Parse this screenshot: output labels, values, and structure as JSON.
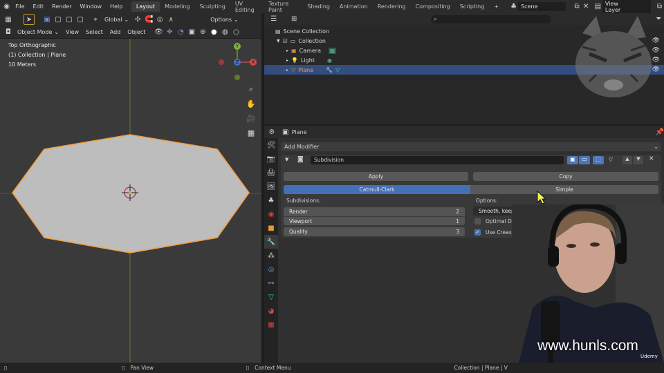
{
  "topbar": {
    "menus": [
      "File",
      "Edit",
      "Render",
      "Window",
      "Help"
    ],
    "workspaces": [
      "Layout",
      "Modeling",
      "Sculpting",
      "UV Editing",
      "Texture Paint",
      "Shading",
      "Animation",
      "Rendering",
      "Compositing",
      "Scripting"
    ],
    "active_workspace": "Layout",
    "add_tab": "+",
    "scene": "Scene",
    "view_layer": "View Layer"
  },
  "viewport_header": {
    "transform_orientation": "Global",
    "options": "Options",
    "mode": "Object Mode",
    "menus": [
      "View",
      "Select",
      "Add",
      "Object"
    ]
  },
  "viewport": {
    "view_name": "Top Orthographic",
    "collection_info": "(1) Collection | Plane",
    "scale": "10 Meters",
    "gizmo": {
      "y": "Y",
      "z": "Z",
      "x": "X"
    },
    "colors": {
      "background": "#3a3a3a",
      "mesh": "#bcbcbc",
      "outline": "#f0a040",
      "x_axis": "#c8464a",
      "y_axis": "#6f9a2b"
    }
  },
  "outliner": {
    "root": "Scene Collection",
    "items": [
      {
        "label": "Collection",
        "level": 1,
        "selected": false
      },
      {
        "label": "Camera",
        "level": 2,
        "selected": false
      },
      {
        "label": "Light",
        "level": 2,
        "selected": false
      },
      {
        "label": "Plane",
        "level": 2,
        "selected": true
      }
    ]
  },
  "properties": {
    "object_name": "Plane",
    "add_modifier": "Add Modifier",
    "modifier": {
      "name": "Subdivision",
      "apply": "Apply",
      "copy": "Copy",
      "type_options": [
        "Catmull-Clark",
        "Simple"
      ],
      "active_type": "Catmull-Clark",
      "subdivisions_label": "Subdivisions:",
      "render_label": "Render",
      "render_value": "2",
      "viewport_label": "Viewport",
      "viewport_value": "1",
      "quality_label": "Quality",
      "quality_value": "3",
      "options_label": "Options:",
      "uv_smooth": "Smooth, keep corners",
      "optimal_display": {
        "label": "Optimal Display",
        "checked": false
      },
      "use_creases": {
        "label": "Use Creases",
        "checked": true
      }
    }
  },
  "overlay": {
    "watermark": "www.hunls.com",
    "brand": "Udemy"
  },
  "statusbar": {
    "pan_view": "Pan View",
    "context_menu": "Context Menu",
    "info": "Collection | Plane | V"
  }
}
